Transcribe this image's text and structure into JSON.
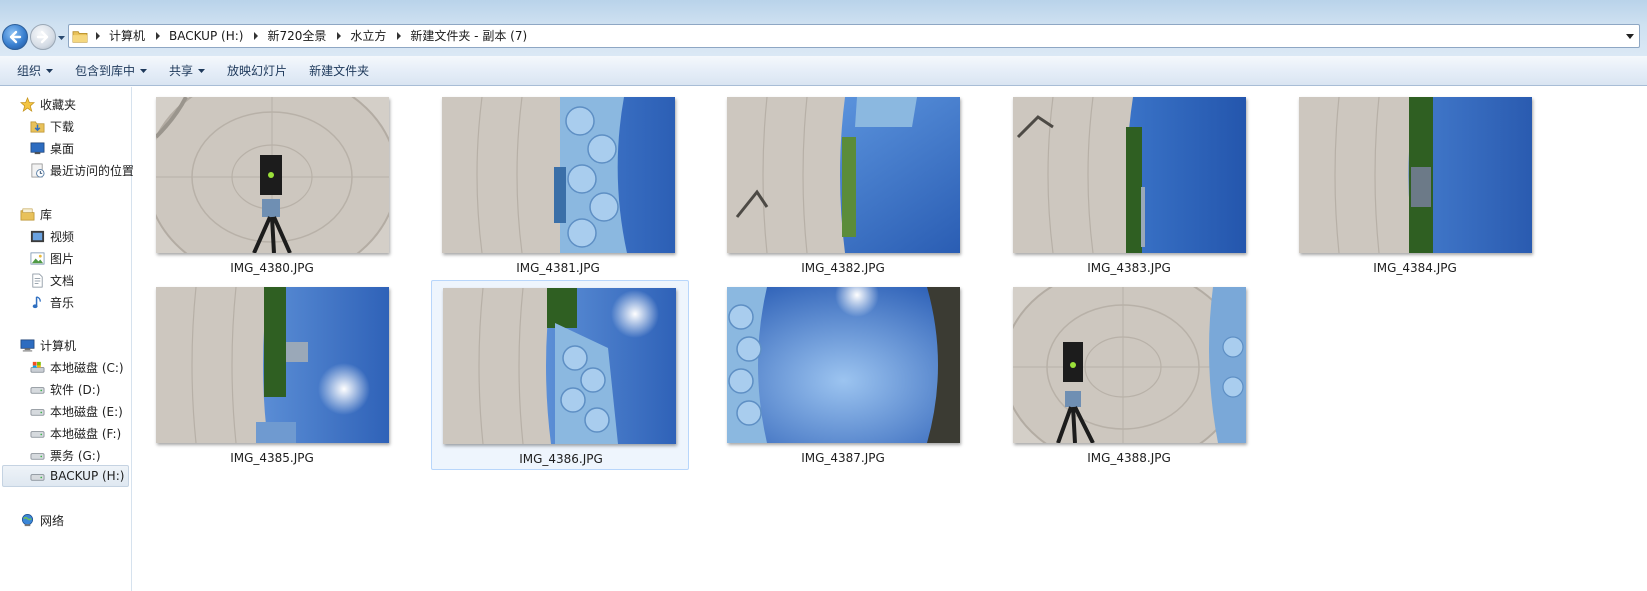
{
  "address_bar": {
    "breadcrumbs": [
      "计算机",
      "BACKUP (H:)",
      "新720全景",
      "水立方",
      "新建文件夹 - 副本 (7)"
    ]
  },
  "toolbar": {
    "items": [
      {
        "label": "组织",
        "dropdown": true
      },
      {
        "label": "包含到库中",
        "dropdown": true
      },
      {
        "label": "共享",
        "dropdown": true
      },
      {
        "label": "放映幻灯片",
        "dropdown": false
      },
      {
        "label": "新建文件夹",
        "dropdown": false
      }
    ]
  },
  "navigation": {
    "favorites": {
      "label": "收藏夹",
      "items": [
        "下载",
        "桌面",
        "最近访问的位置"
      ]
    },
    "libraries": {
      "label": "库",
      "items": [
        "视频",
        "图片",
        "文档",
        "音乐"
      ]
    },
    "computer": {
      "label": "计算机",
      "items": [
        "本地磁盘 (C:)",
        "软件 (D:)",
        "本地磁盘 (E:)",
        "本地磁盘 (F:)",
        "票务 (G:)",
        "BACKUP (H:)"
      ],
      "selected": "BACKUP (H:)"
    },
    "network": {
      "label": "网络"
    }
  },
  "files": [
    {
      "name": "IMG_4380.JPG",
      "icon": "panorama-tripod-floor-thumbnail"
    },
    {
      "name": "IMG_4381.JPG",
      "icon": "panorama-watercube-left-thumbnail"
    },
    {
      "name": "IMG_4382.JPG",
      "icon": "panorama-sky-shadow-thumbnail"
    },
    {
      "name": "IMG_4383.JPG",
      "icon": "panorama-trees-shadow-thumbnail"
    },
    {
      "name": "IMG_4384.JPG",
      "icon": "panorama-trees-building-thumbnail"
    },
    {
      "name": "IMG_4385.JPG",
      "icon": "panorama-sun-trees-thumbnail"
    },
    {
      "name": "IMG_4386.JPG",
      "icon": "panorama-watercube-sun-thumbnail",
      "selected": true
    },
    {
      "name": "IMG_4387.JPG",
      "icon": "panorama-sky-zenith-thumbnail"
    },
    {
      "name": "IMG_4388.JPG",
      "icon": "panorama-tripod-watercube-thumbnail"
    }
  ],
  "colors": {
    "chrome_top": "#b9d3ea",
    "command_bar": "#e6eef8",
    "selection_fill": "#eef5fd",
    "selection_border": "#b8d6fb",
    "sky_blue": "#3f7fd6",
    "plaza_gray": "#cfcac3"
  }
}
